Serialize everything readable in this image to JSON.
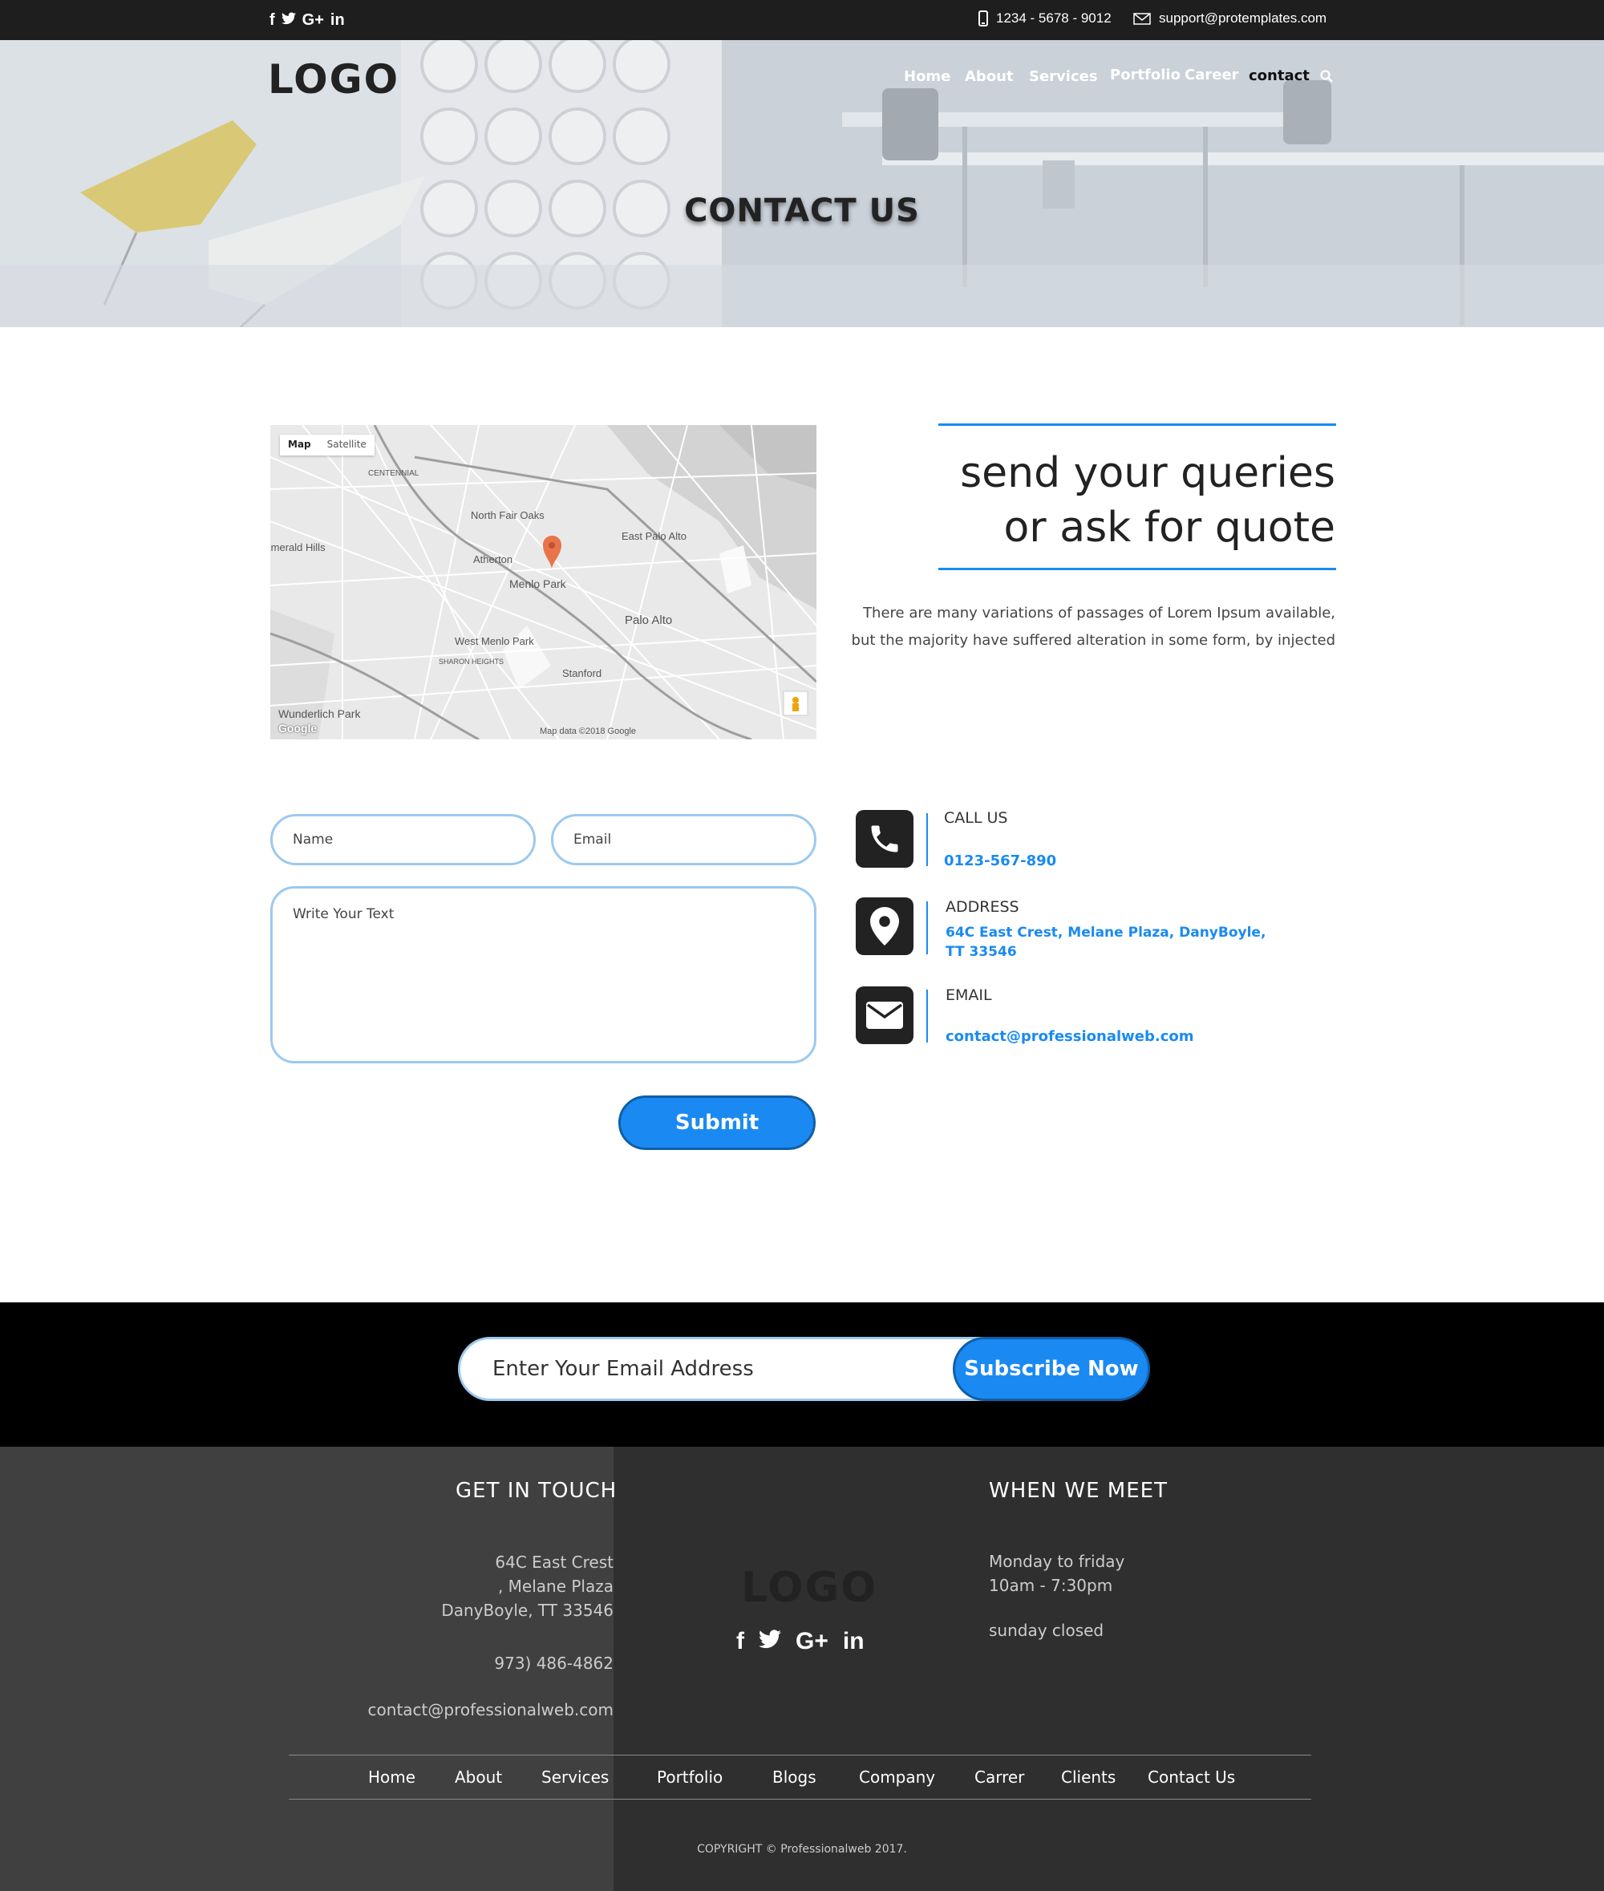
{
  "topbar": {
    "social": [
      "f",
      "t",
      "G+",
      "in"
    ],
    "phone": "1234 - 5678 - 9012",
    "email": "support@protemplates.com"
  },
  "header": {
    "logo": "LOGO",
    "nav": [
      "Home",
      "About",
      "Services",
      "Portfolio",
      "Career",
      "contact"
    ],
    "hero_title": "CONTACT US"
  },
  "map": {
    "tabs": [
      "Map",
      "Satellite"
    ],
    "labels": [
      "North Fair Oaks",
      "East Palo Alto",
      "Atherton",
      "Menlo Park",
      "Palo Alto",
      "West Menlo Park",
      "Stanford",
      "Wunderlich Park",
      "Emerald Hills",
      "CENTENNIAL",
      "SHARON HEIGHTS"
    ],
    "brand": "Google",
    "attribution": "Map data ©2018 Google"
  },
  "quote": {
    "line1": "send your queries",
    "line2": "or ask for quote",
    "para1": "There are many variations of passages of Lorem Ipsum available,",
    "para2": "but the majority have suffered alteration in some form, by injected"
  },
  "form": {
    "name_placeholder": "Name",
    "email_placeholder": "Email",
    "text_placeholder": "Write Your Text",
    "submit": "Submit"
  },
  "contact_info": {
    "call_label": "CALL US",
    "call_value": "0123-567-890",
    "address_label": "ADDRESS",
    "address_line1": "64C East Crest, Melane Plaza, DanyBoyle,",
    "address_line2": "TT 33546",
    "email_label": "EMAIL",
    "email_value": "contact@professionalweb.com"
  },
  "subscribe": {
    "placeholder": "Enter Your Email Address",
    "button": "Subscribe Now"
  },
  "footer": {
    "get_in_touch": "GET IN TOUCH",
    "addr1": "64C East Crest",
    "addr2": ", Melane Plaza",
    "addr3": "DanyBoyle, TT 33546",
    "phone": "973) 486-4862",
    "email": "contact@professionalweb.com",
    "logo": "LOGO",
    "social": [
      "f",
      "t",
      "G+",
      "in"
    ],
    "when_we_meet": "WHEN WE MEET",
    "hours1": "Monday to friday",
    "hours2": "10am - 7:30pm",
    "closed": "sunday closed",
    "links": [
      "Home",
      "About",
      "Services",
      "Portfolio",
      "Blogs",
      "Company",
      "Carrer",
      "Clients",
      "Contact Us"
    ],
    "copyright": "COPYRIGHT © Professionalweb 2017."
  },
  "colors": {
    "accent": "#1a8af2",
    "topbar": "#1e1e1e",
    "footer": "#2f2f2f"
  }
}
